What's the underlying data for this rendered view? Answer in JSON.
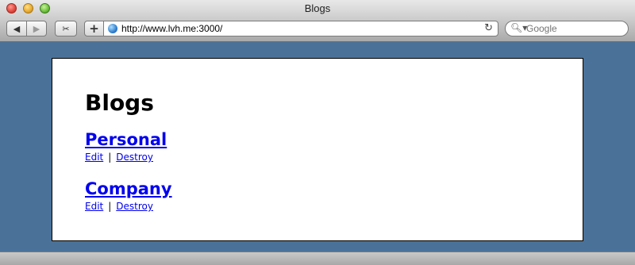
{
  "window": {
    "title": "Blogs"
  },
  "toolbar": {
    "url": "http://www.lvh.me:3000/",
    "search_placeholder": "Google"
  },
  "main": {
    "heading": "Blogs",
    "blogs": [
      {
        "title": "Personal",
        "edit_label": "Edit",
        "destroy_label": "Destroy"
      },
      {
        "title": "Company",
        "edit_label": "Edit",
        "destroy_label": "Destroy"
      }
    ],
    "separator": "|"
  }
}
